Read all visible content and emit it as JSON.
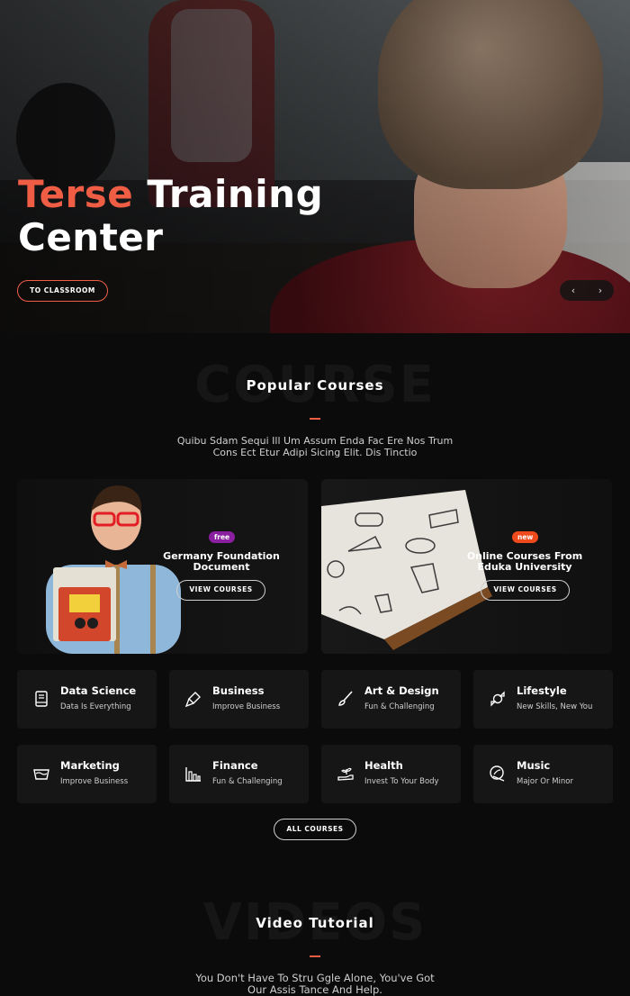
{
  "hero": {
    "title_accent": "Terse",
    "title_rest": "Training",
    "title_line2": "Center",
    "cta_label": "TO CLASSROOM",
    "prev_label": "‹",
    "next_label": "›"
  },
  "courses_section": {
    "ghost_text": "COURSE",
    "title": "Popular Courses",
    "subtitle_line1": "Quibu Sdam Sequi Ill Um Assum Enda Fac Ere Nos Trum",
    "subtitle_line2": "Cons Ect Etur Adipi Sicing Elit. Dis Tinctio"
  },
  "promos": [
    {
      "badge": "free",
      "badge_color": "#8a1fa0",
      "title_line1": "Germany Foundation",
      "title_line2": "Document",
      "button": "VIEW COURSES"
    },
    {
      "badge": "new",
      "badge_color": "#ef4a1c",
      "title_line1": "Online Courses From",
      "title_line2": "Eduka University",
      "button": "VIEW COURSES"
    }
  ],
  "categories": [
    {
      "title": "Data Science",
      "sub": "Data Is Everything",
      "icon": "book-icon"
    },
    {
      "title": "Business",
      "sub": "Improve Business",
      "icon": "brush-icon"
    },
    {
      "title": "Art & Design",
      "sub": "Fun & Challenging",
      "icon": "paintbrush-icon"
    },
    {
      "title": "Lifestyle",
      "sub": "New Skills, New You",
      "icon": "candy-icon"
    },
    {
      "title": "Marketing",
      "sub": "Improve Business",
      "icon": "basket-icon"
    },
    {
      "title": "Finance",
      "sub": "Fun & Challenging",
      "icon": "bar-chart-icon"
    },
    {
      "title": "Health",
      "sub": "Invest To Your Body",
      "icon": "hand-plant-icon"
    },
    {
      "title": "Music",
      "sub": "Major Or Minor",
      "icon": "leaf-icon"
    }
  ],
  "all_courses_label": "ALL COURSES",
  "videos_section": {
    "ghost_text": "VIDEOS",
    "title": "Video Tutorial",
    "subtitle_line1": "You Don't Have To Stru Ggle Alone, You've Got",
    "subtitle_line2": "Our Assis Tance And Help."
  },
  "colors": {
    "accent": "#ef5d45",
    "background": "#0b0b0b",
    "card": "#161616"
  }
}
